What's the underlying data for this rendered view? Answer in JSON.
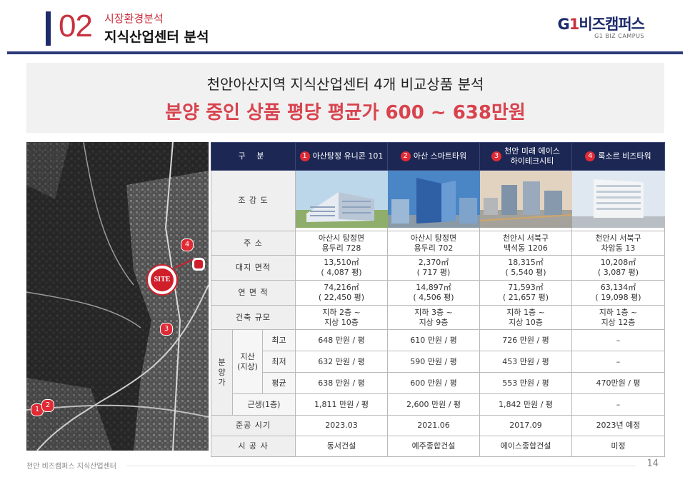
{
  "header": {
    "number": "02",
    "subtitle": "시장환경분석",
    "title": "지식산업센터 분석",
    "logo_prefix": "G",
    "logo_one": "1",
    "logo_text": "비즈캠퍼스",
    "logo_sub": "G1 BIZ CAMPUS"
  },
  "banner": {
    "line1": "천안아산지역 지식산업센터 4개 비교상품 분석",
    "line2": "분양 중인 상품 평당 평균가 600 ~ 638만원"
  },
  "map": {
    "site_label": "SITE",
    "markers": [
      "1",
      "2",
      "3",
      "4"
    ]
  },
  "table": {
    "corner": "구 분",
    "products": [
      {
        "num": "1",
        "name": "아산탕정 유니콘 101"
      },
      {
        "num": "2",
        "name": "아산 스마트타워"
      },
      {
        "num": "3",
        "name": "천안 미래 에이스\n하이테크시티"
      },
      {
        "num": "4",
        "name": "룩소르 비즈타워"
      }
    ],
    "row_labels": {
      "render": "조 감 도",
      "address": "주 소",
      "land_area": "대지 면적",
      "floor_area": "연 면 적",
      "scale": "건축 규모",
      "sale_group": "분\n양\n가",
      "jisan_group": "지산\n(지상)",
      "max": "최고",
      "min": "최저",
      "avg": "평균",
      "retail": "근생(1층)",
      "completion": "준공 시기",
      "builder": "시 공 사"
    },
    "address": [
      "아산시 탕정면\n용두리 728",
      "아산시 탕정면\n용두리 702",
      "천안시 서북구\n백석동 1206",
      "천안시 서북구\n차암동 13"
    ],
    "land_area": [
      "13,510㎡\n( 4,087 평)",
      "2,370㎡\n( 717 평)",
      "18,315㎡\n( 5,540 평)",
      "10,208㎡\n( 3,087 평)"
    ],
    "floor_area": [
      "74,216㎡\n( 22,450 평)",
      "14,897㎡\n( 4,506 평)",
      "71,593㎡\n( 21,657 평)",
      "63,134㎡\n( 19,098 평)"
    ],
    "scale": [
      "지하 2층 ~\n지상 10층",
      "지하 3층 ~\n지상 9층",
      "지하 1층 ~\n지상 10층",
      "지하 1층 ~\n지상 12층"
    ],
    "max": [
      "648 만원 / 평",
      "610 만원 / 평",
      "726 만원 / 평",
      "–"
    ],
    "min": [
      "632 만원 / 평",
      "590 만원 / 평",
      "453 만원 / 평",
      "–"
    ],
    "avg": [
      "638 만원 / 평",
      "600 만원 / 평",
      "553 만원 / 평",
      "470만원 / 평"
    ],
    "retail": [
      "1,811 만원 / 평",
      "2,600 만원 / 평",
      "1,842 만원 / 평",
      "–"
    ],
    "completion": [
      "2023.03",
      "2021.06",
      "2017.09",
      "2023년 예정"
    ],
    "builder": [
      "동서건설",
      "예주종합건설",
      "에이스종합건설",
      "미정"
    ]
  },
  "footer": {
    "text": "천안 비즈캠퍼스 지식산업센터",
    "page": "14"
  },
  "colors": {
    "navy": "#1c2754",
    "accent_red": "#d8434e",
    "marker_red": "#e02a35"
  }
}
